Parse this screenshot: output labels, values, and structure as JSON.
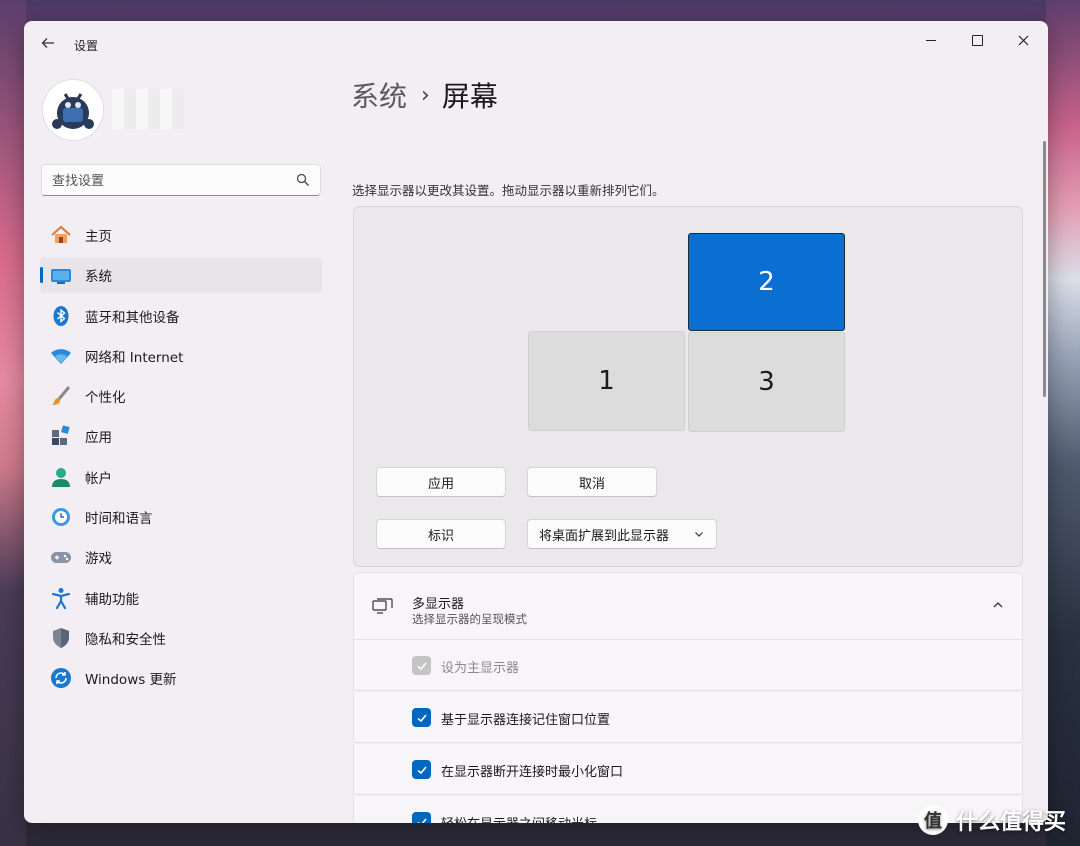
{
  "app": {
    "title": "设置"
  },
  "search": {
    "placeholder": "查找设置"
  },
  "nav": {
    "items": [
      {
        "label": "主页",
        "icon": "home-icon"
      },
      {
        "label": "系统",
        "icon": "system-icon",
        "active": true
      },
      {
        "label": "蓝牙和其他设备",
        "icon": "bluetooth-icon"
      },
      {
        "label": "网络和 Internet",
        "icon": "wifi-icon"
      },
      {
        "label": "个性化",
        "icon": "brush-icon"
      },
      {
        "label": "应用",
        "icon": "apps-icon"
      },
      {
        "label": "帐户",
        "icon": "account-icon"
      },
      {
        "label": "时间和语言",
        "icon": "time-language-icon"
      },
      {
        "label": "游戏",
        "icon": "gamepad-icon"
      },
      {
        "label": "辅助功能",
        "icon": "accessibility-icon"
      },
      {
        "label": "隐私和安全性",
        "icon": "shield-icon"
      },
      {
        "label": "Windows 更新",
        "icon": "update-icon"
      }
    ]
  },
  "breadcrumb": {
    "parent": "系统",
    "separator": "›",
    "current": "屏幕"
  },
  "main": {
    "description": "选择显示器以更改其设置。拖动显示器以重新排列它们。",
    "monitors": [
      "1",
      "2",
      "3"
    ],
    "buttons": {
      "apply": "应用",
      "cancel": "取消",
      "identify": "标识"
    },
    "extend_dropdown": "将桌面扩展到此显示器"
  },
  "multi_display": {
    "title": "多显示器",
    "subtitle": "选择显示器的呈现模式",
    "options": [
      {
        "label": "设为主显示器",
        "checked": true,
        "disabled": true
      },
      {
        "label": "基于显示器连接记住窗口位置",
        "checked": true
      },
      {
        "label": "在显示器断开连接时最小化窗口",
        "checked": true
      },
      {
        "label": "轻松在显示器之间移动光标",
        "checked": true
      }
    ]
  },
  "colors": {
    "accent": "#0067c0",
    "selected_monitor": "#0a6fd0"
  },
  "watermark": "什么值得买"
}
